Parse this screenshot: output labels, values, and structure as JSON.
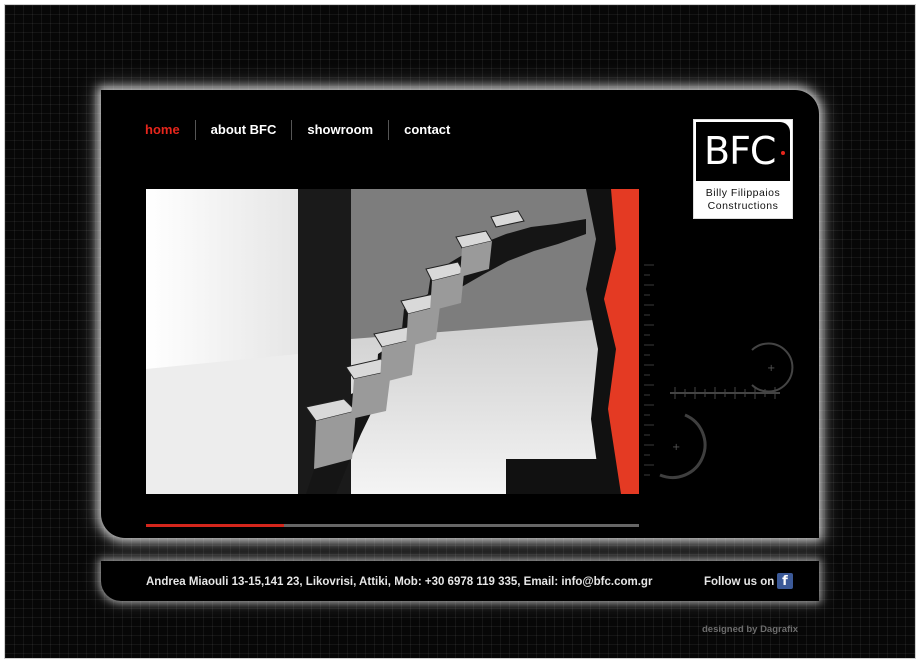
{
  "nav": {
    "items": [
      {
        "label": "home",
        "active": true
      },
      {
        "label": "about BFC",
        "active": false
      },
      {
        "label": "showroom",
        "active": false
      },
      {
        "label": "contact",
        "active": false
      }
    ]
  },
  "logo": {
    "mark": "BFC",
    "tagline_line1": "Billy Filippaios",
    "tagline_line2": "Constructions"
  },
  "slideshow": {
    "image_icon": "staircase-photo",
    "progress_fraction": 0.28
  },
  "footer": {
    "address": "Andrea Miaouli 13-15,141 23, Likovrisi, Attiki, Mob: +30 6978 119 335, Email: info@bfc.com.gr",
    "follow_label": "Follow us on",
    "social_icon": "facebook-icon",
    "social_glyph": "f"
  },
  "credit": "designed by Dagrafix",
  "colors": {
    "accent": "#e6261c",
    "background": "#070707",
    "panel": "#000000",
    "facebook": "#3b5998"
  }
}
